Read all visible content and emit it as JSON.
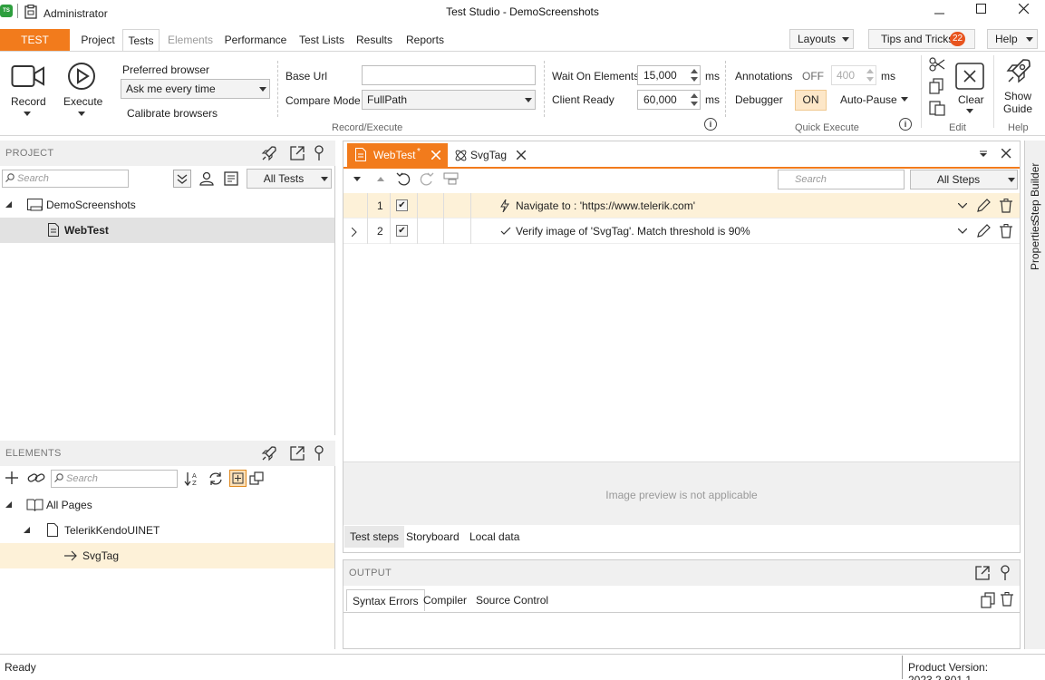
{
  "window": {
    "title": "Test Studio - DemoScreenshots",
    "user": "Administrator",
    "logo": "TS"
  },
  "menu": {
    "brand": "TEST STUDIO",
    "items": [
      "Project",
      "Tests",
      "Elements",
      "Performance",
      "Test Lists",
      "Results",
      "Reports"
    ],
    "layouts": "Layouts",
    "tips": "Tips and Tricks",
    "tips_count": "22",
    "help": "Help"
  },
  "ribbon": {
    "record": "Record",
    "execute": "Execute",
    "preferred_browser_label": "Preferred browser",
    "preferred_browser_value": "Ask me every time",
    "calibrate": "Calibrate browsers",
    "base_url_label": "Base Url",
    "base_url_value": "",
    "compare_mode_label": "Compare Mode",
    "compare_mode_value": "FullPath",
    "group_record_execute": "Record/Execute",
    "wait_on_elements_label": "Wait On Elements",
    "wait_on_elements_value": "15,000",
    "client_ready_label": "Client Ready",
    "client_ready_value": "60,000",
    "ms": "ms",
    "annotations_label": "Annotations",
    "annotations_state": "OFF",
    "annotations_value": "400",
    "debugger_label": "Debugger",
    "debugger_state": "ON",
    "auto_pause": "Auto-Pause",
    "group_quick_execute": "Quick Execute",
    "clear": "Clear",
    "group_edit": "Edit",
    "show_guide_line1": "Show",
    "show_guide_line2": "Guide",
    "group_help": "Help"
  },
  "project_panel": {
    "title": "PROJECT",
    "search_placeholder": "Search",
    "filter": "All Tests",
    "tree": [
      {
        "label": "DemoScreenshots"
      },
      {
        "label": "WebTest"
      }
    ]
  },
  "elements_panel": {
    "title": "ELEMENTS",
    "search_placeholder": "Search",
    "tree": [
      {
        "label": "All Pages"
      },
      {
        "label": "TelerikKendoUINET"
      },
      {
        "label": "SvgTag"
      }
    ]
  },
  "editor": {
    "tabs": [
      {
        "label": "WebTest",
        "modified": "*"
      },
      {
        "label": "SvgTag"
      }
    ],
    "search_placeholder": "Search",
    "filter": "All Steps",
    "steps": [
      {
        "num": "1",
        "text": "Navigate to : 'https://www.telerik.com'"
      },
      {
        "num": "2",
        "text": "Verify image of 'SvgTag'. Match threshold is 90%"
      }
    ],
    "preview_text": "Image preview is not applicable",
    "bottom_tabs": [
      "Test steps",
      "Storyboard",
      "Local data"
    ]
  },
  "output": {
    "title": "OUTPUT",
    "tabs": [
      "Syntax Errors",
      "Compiler",
      "Source Control"
    ]
  },
  "side_tabs": [
    "Step Builder",
    "Properties"
  ],
  "status": {
    "text": "Ready",
    "version": "Product Version: 2023.2.801.1"
  }
}
